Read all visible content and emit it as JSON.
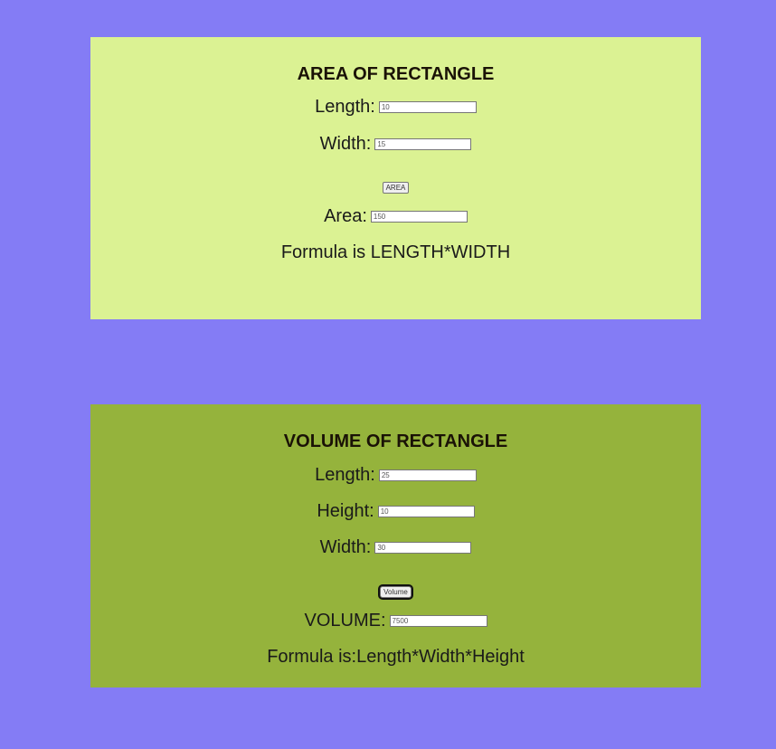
{
  "area_panel": {
    "title": "AREA OF RECTANGLE",
    "length_label": "Length:",
    "length_value": "10",
    "width_label": "Width:",
    "width_value": "15",
    "button_label": "AREA",
    "area_label": "Area:",
    "area_value": "150",
    "formula": "Formula is LENGTH*WIDTH"
  },
  "volume_panel": {
    "title": "VOLUME OF RECTANGLE",
    "length_label": "Length:",
    "length_value": "25",
    "height_label": "Height:",
    "height_value": "10",
    "width_label": "Width:",
    "width_value": "30",
    "button_label": "Volume",
    "volume_label": "VOLUME:",
    "volume_value": "7500",
    "formula": "Formula is:Length*Width*Height"
  },
  "colors": {
    "page_background": "#847cf5",
    "area_panel_background": "#dbf293",
    "volume_panel_background": "#95b33c"
  }
}
